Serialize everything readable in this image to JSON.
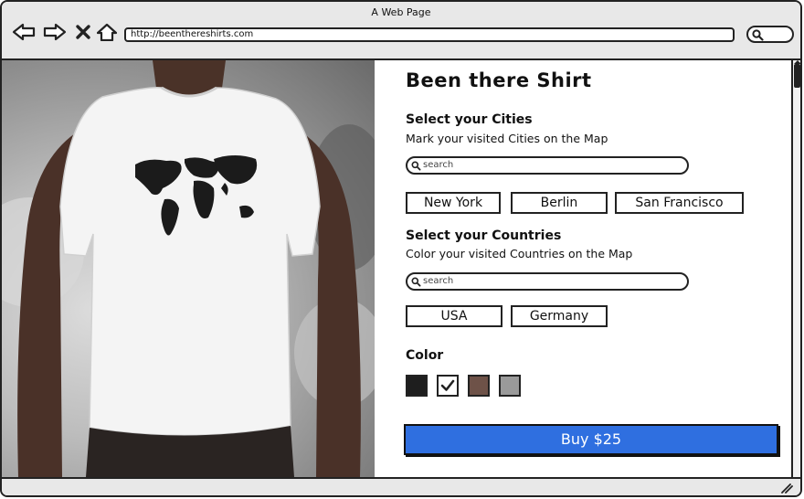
{
  "window": {
    "title": "A Web Page",
    "url": "http://beenthereshirts.com"
  },
  "toolbar": {
    "back_icon": "back-arrow-icon",
    "forward_icon": "forward-arrow-icon",
    "stop_icon": "close-icon",
    "home_icon": "home-icon",
    "search_icon": "search-icon"
  },
  "product": {
    "title": "Been there Shirt",
    "cities": {
      "heading": "Select your Cities",
      "description": "Mark your visited Cities on the Map",
      "search_placeholder": "search",
      "items": [
        "New York",
        "Berlin",
        "San Francisco"
      ]
    },
    "countries": {
      "heading": "Select your Countries",
      "description": "Color your visited Countries on the Map",
      "search_placeholder": "search",
      "items": [
        "USA",
        "Germany"
      ]
    },
    "color": {
      "heading": "Color",
      "swatches": [
        {
          "color": "#1e1e1e",
          "selected": false
        },
        {
          "color": "#ffffff",
          "selected": true
        },
        {
          "color": "#6e5248",
          "selected": false
        },
        {
          "color": "#9a9a9a",
          "selected": false
        }
      ]
    },
    "buy_label": "Buy $25"
  },
  "colors": {
    "accent": "#2f6fe0",
    "border": "#222222"
  }
}
